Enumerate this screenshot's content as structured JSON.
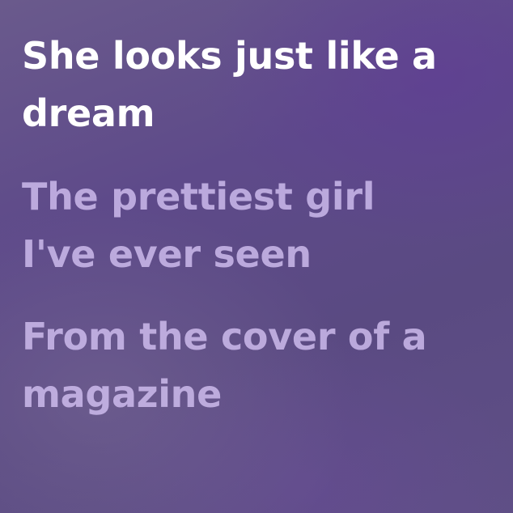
{
  "lyrics": {
    "current_line": {
      "row1": "She looks just like a",
      "row2": "dream"
    },
    "next_line": {
      "row1": "The prettiest girl",
      "row2": "I've ever seen"
    },
    "following_line": {
      "row1": "From the cover of a",
      "row2": "magazine"
    }
  },
  "colors": {
    "active_text": "#ffffff",
    "inactive_text": "#d6c4f5",
    "background": "#5e4a8a"
  }
}
